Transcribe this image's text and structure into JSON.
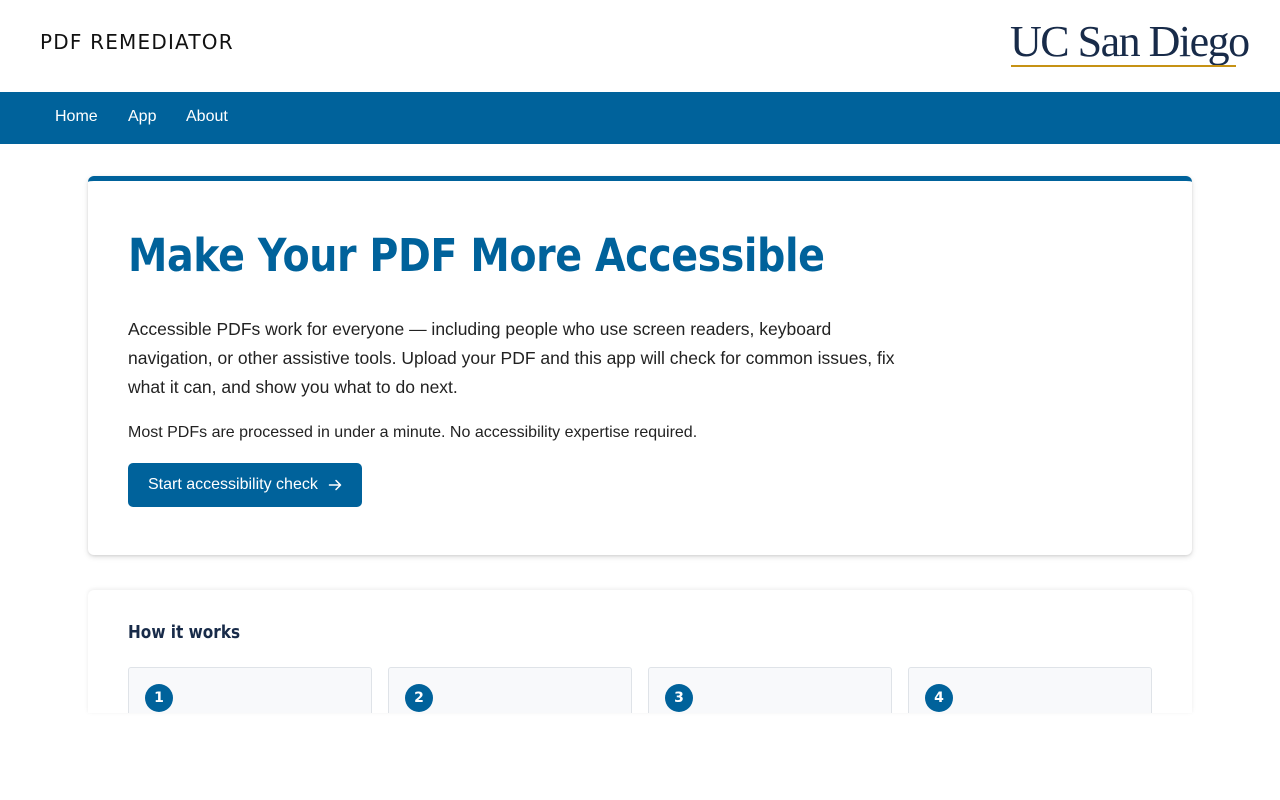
{
  "header": {
    "brand": "PDF REMEDIATOR",
    "logo_text": "UC San Diego"
  },
  "nav": {
    "items": [
      {
        "label": "Home"
      },
      {
        "label": "App"
      },
      {
        "label": "About"
      }
    ]
  },
  "hero": {
    "title": "Make Your PDF More Accessible",
    "description": "Accessible PDFs work for everyone — including people who use screen readers, keyboard navigation, or other assistive tools. Upload your PDF and this app will check for common issues, fix what it can, and show you what to do next.",
    "note": "Most PDFs are processed in under a minute. No accessibility expertise required.",
    "cta_label": "Start accessibility check",
    "cta_icon": "arrow-right-icon"
  },
  "how_it_works": {
    "title": "How it works",
    "steps": [
      {
        "number": "1"
      },
      {
        "number": "2"
      },
      {
        "number": "3"
      },
      {
        "number": "4"
      }
    ]
  },
  "colors": {
    "primary": "#00629b",
    "navy": "#182b49",
    "gold": "#c69214"
  }
}
